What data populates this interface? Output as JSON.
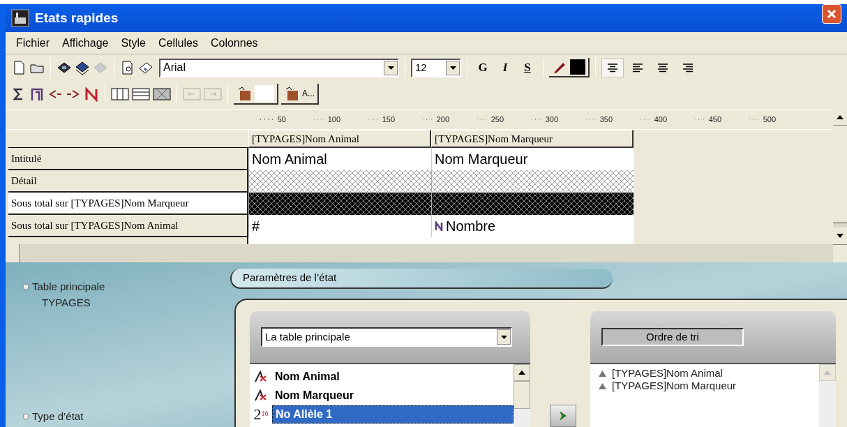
{
  "window": {
    "title": "Etats rapides"
  },
  "menu": [
    "Fichier",
    "Affichage",
    "Style",
    "Cellules",
    "Colonnes"
  ],
  "toolbar": {
    "font": "Arial",
    "size": "12",
    "bold": "G",
    "italic": "I",
    "underline": "S",
    "alignments": [
      {
        "kind": "left",
        "selected": true
      },
      {
        "kind": "center",
        "selected": false
      },
      {
        "kind": "middle",
        "selected": false
      },
      {
        "kind": "right",
        "selected": false
      }
    ],
    "text_style_button": "A..."
  },
  "ruler": {
    "ticks": [
      "50",
      "100",
      "150",
      "200",
      "250",
      "300",
      "350",
      "400",
      "450",
      "500"
    ]
  },
  "grid": {
    "columns": [
      "[TYPAGES]Nom Animal",
      "[TYPAGES]Nom Marqueur"
    ],
    "rows": [
      {
        "label": "Intitulé",
        "kind": "text",
        "selected": false,
        "cells": [
          {
            "text": "Nom Animal"
          },
          {
            "text": "Nom Marqueur"
          }
        ]
      },
      {
        "label": "Détail",
        "kind": "light_hatch",
        "selected": false
      },
      {
        "label": "Sous total sur [TYPAGES]Nom Marqueur",
        "kind": "dark_hatch",
        "selected": true
      },
      {
        "label": "Sous total sur [TYPAGES]Nom Animal",
        "kind": "text",
        "selected": false,
        "cells": [
          {
            "text": "#"
          },
          {
            "text": "Nombre",
            "kind": "function"
          }
        ]
      }
    ]
  },
  "sidebar": [
    {
      "label": "Table principale",
      "value": "TYPAGES"
    },
    {
      "label": "Type d’état"
    }
  ],
  "tab": "Paramètres de l’état",
  "table_select": "La table principale",
  "fields": [
    {
      "name": "Nom Animal",
      "kind": "text",
      "selected": false
    },
    {
      "name": "Nom Marqueur",
      "kind": "text",
      "selected": false
    },
    {
      "name": "No Allèle 1",
      "kind": "integer",
      "type_icon": "2$^{16}$",
      "selected": true
    }
  ],
  "sort": {
    "title": "Ordre de tri",
    "items": [
      {
        "text": "[TYPAGES]Nom Animal",
        "ascending": true
      },
      {
        "text": "[TYPAGES]Nom Marqueur",
        "ascending": true
      }
    ]
  }
}
